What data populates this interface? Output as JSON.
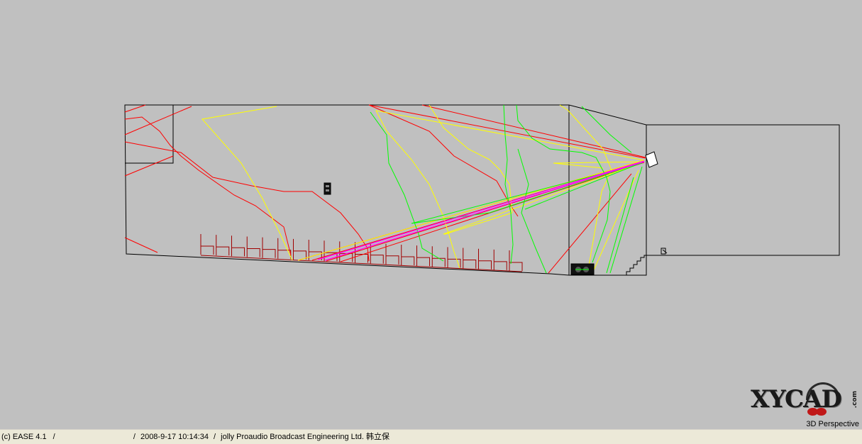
{
  "viewport": {
    "background": "#c0c0c0",
    "view_mode": "3D Perspective"
  },
  "logo": {
    "text": "XYCAD",
    "suffix": ".com",
    "accent": "#c01818"
  },
  "status_bar": {
    "app": "(c) EASE 4.1",
    "sep1": "/",
    "project": "",
    "sep2": "/",
    "datetime": "2008-9-17 10:14:34",
    "sep3": "/",
    "company": "jolly Proaudio Broadcast Engineering Ltd. 韩立保"
  },
  "ray_colors": {
    "red": "#ff0000",
    "yellow": "#ffff00",
    "green": "#00ff00",
    "magenta": "#ff00ff",
    "dark_red": "#a00000",
    "outline": "#000000"
  },
  "icons": {
    "speaker": "loudspeaker-icon",
    "listener": "listener-icon",
    "seat": "seat-icon",
    "subwoofer": "subwoofer-icon"
  }
}
